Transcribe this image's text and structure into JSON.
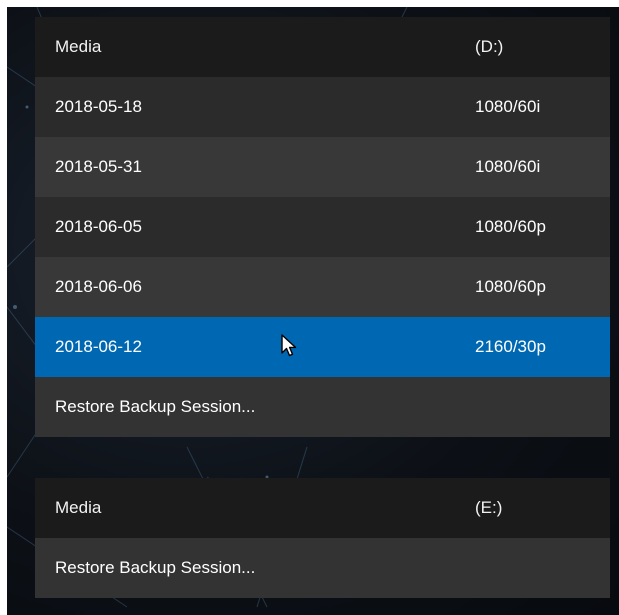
{
  "colors": {
    "header_bg": "#1b1b1b",
    "row_dark": "#2b2b2b",
    "row_light": "#383838",
    "selected": "#0068b3",
    "text": "#ffffff"
  },
  "drive_d": {
    "header": {
      "name": "Media",
      "drive": "(D:)"
    },
    "sessions": [
      {
        "date": "2018-05-18",
        "format": "1080/60i"
      },
      {
        "date": "2018-05-31",
        "format": "1080/60i"
      },
      {
        "date": "2018-06-05",
        "format": "1080/60p"
      },
      {
        "date": "2018-06-06",
        "format": "1080/60p"
      },
      {
        "date": "2018-06-12",
        "format": "2160/30p"
      }
    ],
    "selected_index": 4,
    "restore_label": "Restore Backup Session..."
  },
  "drive_e": {
    "header": {
      "name": "Media",
      "drive": "(E:)"
    },
    "restore_label": "Restore Backup Session..."
  },
  "icons": {
    "cursor": "mouse-pointer-icon"
  }
}
